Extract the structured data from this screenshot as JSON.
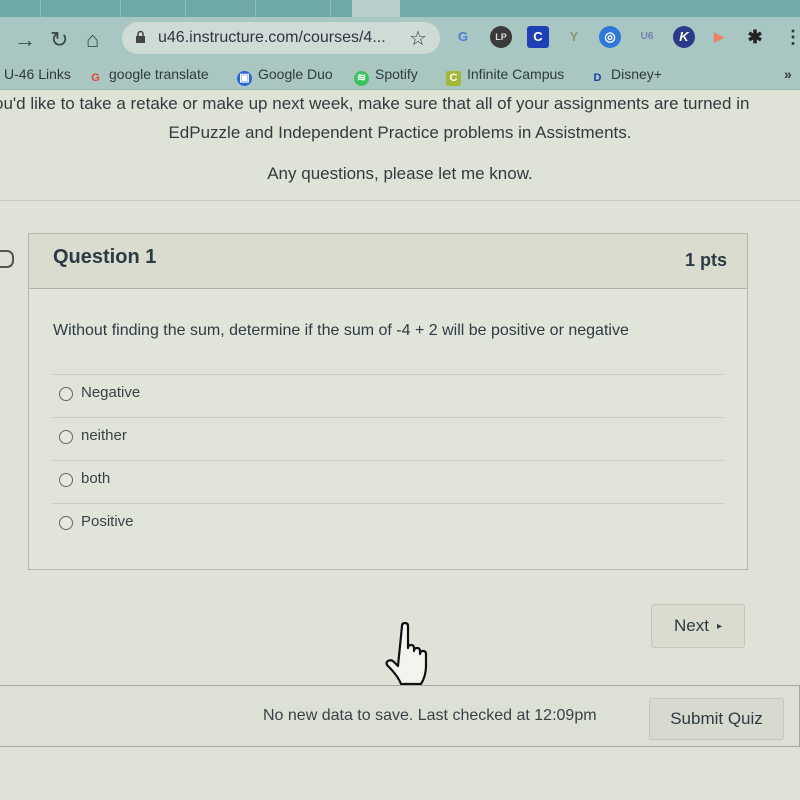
{
  "browser": {
    "url": "u46.instructure.com/courses/4...",
    "extensions": [
      {
        "name": "google-translate-extension-icon",
        "glyph": "G",
        "color": "#4a7fd6"
      },
      {
        "name": "lp-extension-icon",
        "glyph": "LP",
        "color": "#3a3a3a"
      },
      {
        "name": "c-extension-icon",
        "glyph": "C",
        "color": "#1f3fb5"
      },
      {
        "name": "palm-extension-icon",
        "glyph": "Y",
        "color": "#8a9a6a"
      },
      {
        "name": "shield-extension-icon",
        "glyph": "◎",
        "color": "#2f78d8"
      },
      {
        "name": "u46-extension-icon",
        "glyph": "U6",
        "color": "#7a7fb0"
      },
      {
        "name": "k-extension-icon",
        "glyph": "K",
        "color": "#2d3a8c"
      },
      {
        "name": "play-extension-icon",
        "glyph": "▶",
        "color": "#f07e6a"
      },
      {
        "name": "puzzle-extension-icon",
        "glyph": "✱",
        "color": "#222222"
      }
    ],
    "bookmarks": [
      {
        "label": "U-46 Links",
        "icon": "none"
      },
      {
        "label": "google translate",
        "icon": "G",
        "color": "#e0443a"
      },
      {
        "label": "Google Duo",
        "icon": "▣",
        "color": "#2c63d6"
      },
      {
        "label": "Spotify",
        "icon": "≋",
        "color": "#3cc25a"
      },
      {
        "label": "Infinite Campus",
        "icon": "C",
        "color": "#a3b83a"
      },
      {
        "label": "Disney+",
        "icon": "D",
        "color": "#1a3c9a"
      }
    ],
    "more_bookmarks": "»"
  },
  "intro": {
    "line1": "ou'd like to take a retake or make up next week, make sure that all of your assignments are turned in",
    "line2": "EdPuzzle and Independent Practice problems in Assistments.",
    "line3": "Any questions, please let me know."
  },
  "question": {
    "title": "Question 1",
    "points": "1 pts",
    "text": "Without finding the sum, determine if the sum of -4 + 2 will be positive or negative",
    "answers": [
      "Negative",
      "neither",
      "both",
      "Positive"
    ],
    "selected": null
  },
  "nav": {
    "next_label": "Next",
    "next_arrow": "▸"
  },
  "footer": {
    "status": "No new data to save. Last checked at 12:09pm",
    "submit_label": "Submit Quiz"
  }
}
